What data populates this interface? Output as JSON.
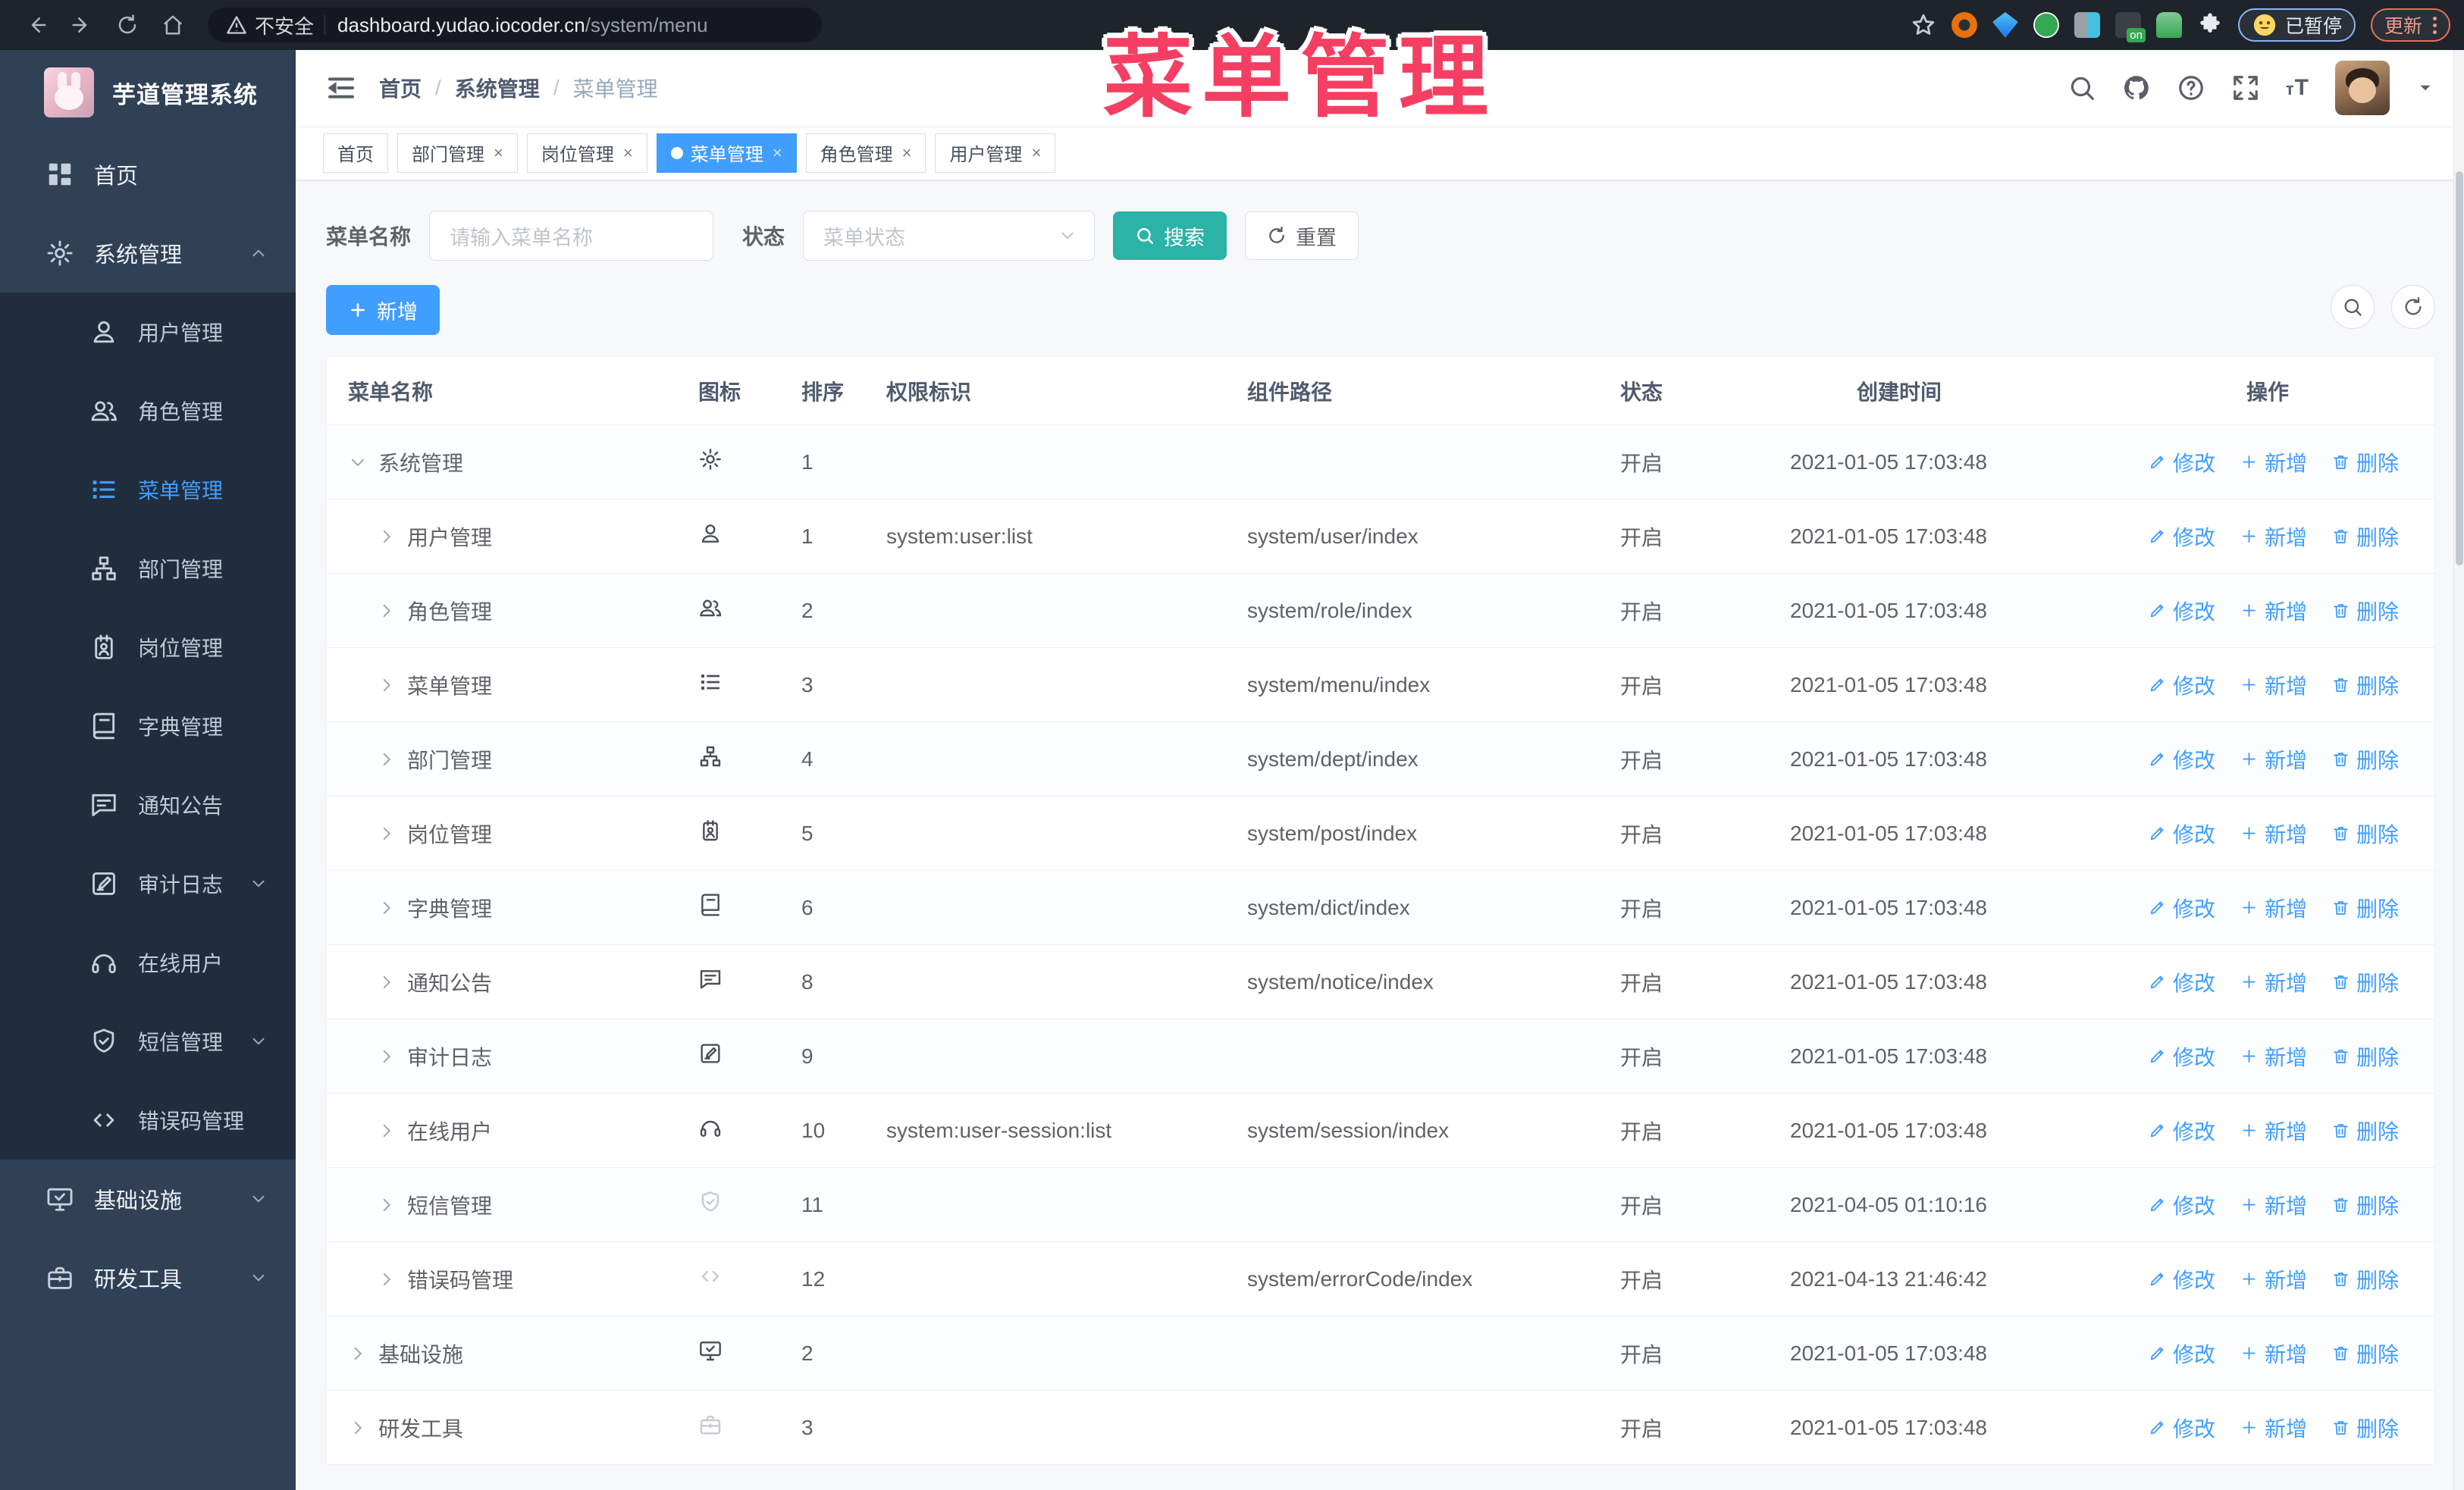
{
  "browser": {
    "security_label": "不安全",
    "url_host": "dashboard.yudao.iocoder.cn",
    "url_path": "/system/menu",
    "paused_badge": "已暂停",
    "update_button": "更新"
  },
  "annotation": {
    "text": "菜单管理"
  },
  "sidebar": {
    "logo_title": "芋道管理系统",
    "items": [
      {
        "label": "首页",
        "icon": "dashboard",
        "type": "top"
      },
      {
        "label": "系统管理",
        "icon": "gear",
        "type": "top",
        "arrow": "up"
      },
      {
        "label": "用户管理",
        "icon": "user",
        "type": "sub"
      },
      {
        "label": "角色管理",
        "icon": "users",
        "type": "sub"
      },
      {
        "label": "菜单管理",
        "icon": "menu",
        "type": "sub",
        "active": true
      },
      {
        "label": "部门管理",
        "icon": "tree",
        "type": "sub"
      },
      {
        "label": "岗位管理",
        "icon": "post",
        "type": "sub"
      },
      {
        "label": "字典管理",
        "icon": "dict",
        "type": "sub"
      },
      {
        "label": "通知公告",
        "icon": "notice",
        "type": "sub"
      },
      {
        "label": "审计日志",
        "icon": "log",
        "type": "sub",
        "arrow": "down"
      },
      {
        "label": "在线用户",
        "icon": "online",
        "type": "sub"
      },
      {
        "label": "短信管理",
        "icon": "sms",
        "type": "sub",
        "arrow": "down"
      },
      {
        "label": "错误码管理",
        "icon": "code",
        "type": "sub"
      },
      {
        "label": "基础设施",
        "icon": "infra",
        "type": "top",
        "arrow": "down"
      },
      {
        "label": "研发工具",
        "icon": "tool",
        "type": "top",
        "arrow": "down"
      }
    ]
  },
  "header": {
    "breadcrumb": [
      "首页",
      "系统管理",
      "菜单管理"
    ]
  },
  "tabs": [
    {
      "label": "首页",
      "active": false,
      "closable": false
    },
    {
      "label": "部门管理",
      "active": false,
      "closable": true
    },
    {
      "label": "岗位管理",
      "active": false,
      "closable": true
    },
    {
      "label": "菜单管理",
      "active": true,
      "closable": true
    },
    {
      "label": "角色管理",
      "active": false,
      "closable": true
    },
    {
      "label": "用户管理",
      "active": false,
      "closable": true
    }
  ],
  "filters": {
    "name_label": "菜单名称",
    "name_placeholder": "请输入菜单名称",
    "status_label": "状态",
    "status_placeholder": "菜单状态",
    "search_label": "搜索",
    "reset_label": "重置"
  },
  "toolbar": {
    "add_label": "新增"
  },
  "table": {
    "columns": [
      "菜单名称",
      "图标",
      "排序",
      "权限标识",
      "组件路径",
      "状态",
      "创建时间",
      "操作"
    ],
    "action_labels": {
      "edit": "修改",
      "add": "新增",
      "delete": "删除"
    },
    "rows": [
      {
        "name": "系统管理",
        "icon": "gear",
        "tone": "dark",
        "level": 0,
        "expanded": true,
        "sort": "1",
        "perm": "",
        "path": "",
        "status": "开启",
        "time": "2021-01-05 17:03:48"
      },
      {
        "name": "用户管理",
        "icon": "user",
        "tone": "dark",
        "level": 1,
        "expanded": false,
        "sort": "1",
        "perm": "system:user:list",
        "path": "system/user/index",
        "status": "开启",
        "time": "2021-01-05 17:03:48"
      },
      {
        "name": "角色管理",
        "icon": "users",
        "tone": "dark",
        "level": 1,
        "expanded": false,
        "sort": "2",
        "perm": "",
        "path": "system/role/index",
        "status": "开启",
        "time": "2021-01-05 17:03:48"
      },
      {
        "name": "菜单管理",
        "icon": "menu",
        "tone": "dark",
        "level": 1,
        "expanded": false,
        "sort": "3",
        "perm": "",
        "path": "system/menu/index",
        "status": "开启",
        "time": "2021-01-05 17:03:48"
      },
      {
        "name": "部门管理",
        "icon": "tree",
        "tone": "dark",
        "level": 1,
        "expanded": false,
        "sort": "4",
        "perm": "",
        "path": "system/dept/index",
        "status": "开启",
        "time": "2021-01-05 17:03:48"
      },
      {
        "name": "岗位管理",
        "icon": "post",
        "tone": "dark",
        "level": 1,
        "expanded": false,
        "sort": "5",
        "perm": "",
        "path": "system/post/index",
        "status": "开启",
        "time": "2021-01-05 17:03:48"
      },
      {
        "name": "字典管理",
        "icon": "dict",
        "tone": "dark",
        "level": 1,
        "expanded": false,
        "sort": "6",
        "perm": "",
        "path": "system/dict/index",
        "status": "开启",
        "time": "2021-01-05 17:03:48"
      },
      {
        "name": "通知公告",
        "icon": "notice",
        "tone": "dark",
        "level": 1,
        "expanded": false,
        "sort": "8",
        "perm": "",
        "path": "system/notice/index",
        "status": "开启",
        "time": "2021-01-05 17:03:48"
      },
      {
        "name": "审计日志",
        "icon": "log",
        "tone": "dark",
        "level": 1,
        "expanded": false,
        "sort": "9",
        "perm": "",
        "path": "",
        "status": "开启",
        "time": "2021-01-05 17:03:48"
      },
      {
        "name": "在线用户",
        "icon": "online",
        "tone": "dark",
        "level": 1,
        "expanded": false,
        "sort": "10",
        "perm": "system:user-session:list",
        "path": "system/session/index",
        "status": "开启",
        "time": "2021-01-05 17:03:48"
      },
      {
        "name": "短信管理",
        "icon": "sms",
        "tone": "light",
        "level": 1,
        "expanded": false,
        "sort": "11",
        "perm": "",
        "path": "",
        "status": "开启",
        "time": "2021-04-05 01:10:16"
      },
      {
        "name": "错误码管理",
        "icon": "code",
        "tone": "light",
        "level": 1,
        "expanded": false,
        "sort": "12",
        "perm": "",
        "path": "system/errorCode/index",
        "status": "开启",
        "time": "2021-04-13 21:46:42"
      },
      {
        "name": "基础设施",
        "icon": "infra",
        "tone": "dark",
        "level": 0,
        "expanded": false,
        "sort": "2",
        "perm": "",
        "path": "",
        "status": "开启",
        "time": "2021-01-05 17:03:48"
      },
      {
        "name": "研发工具",
        "icon": "tool",
        "tone": "light",
        "level": 0,
        "expanded": false,
        "sort": "3",
        "perm": "",
        "path": "",
        "status": "开启",
        "time": "2021-01-05 17:03:48"
      }
    ]
  }
}
